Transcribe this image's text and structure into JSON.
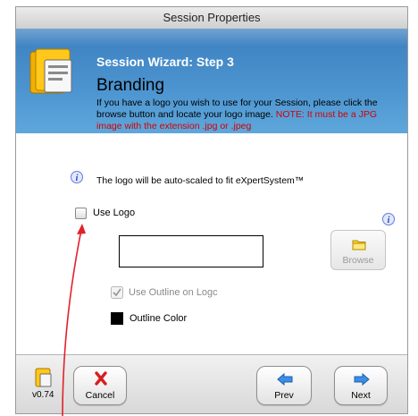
{
  "window": {
    "title": "Session Properties"
  },
  "header": {
    "step": "Session Wizard: Step 3",
    "heading": "Branding",
    "description": "If you have a logo you wish to use for your Session, please click the browse button and locate your logo image. ",
    "note": "NOTE: It must be a JPG image with the extension .jpg or .jpeg"
  },
  "info": {
    "text": "The logo will be auto-scaled to fit eXpertSystem™"
  },
  "form": {
    "use_logo_label": "Use Logo",
    "use_logo_checked": false,
    "browse_label": "Browse",
    "use_outline_label": "Use Outline on Logc",
    "use_outline_checked": true,
    "outline_color_label": "Outline Color",
    "outline_color": "#000000"
  },
  "footer": {
    "version": "v0.74",
    "cancel_label": "Cancel",
    "prev_label": "Prev",
    "next_label": "Next"
  }
}
